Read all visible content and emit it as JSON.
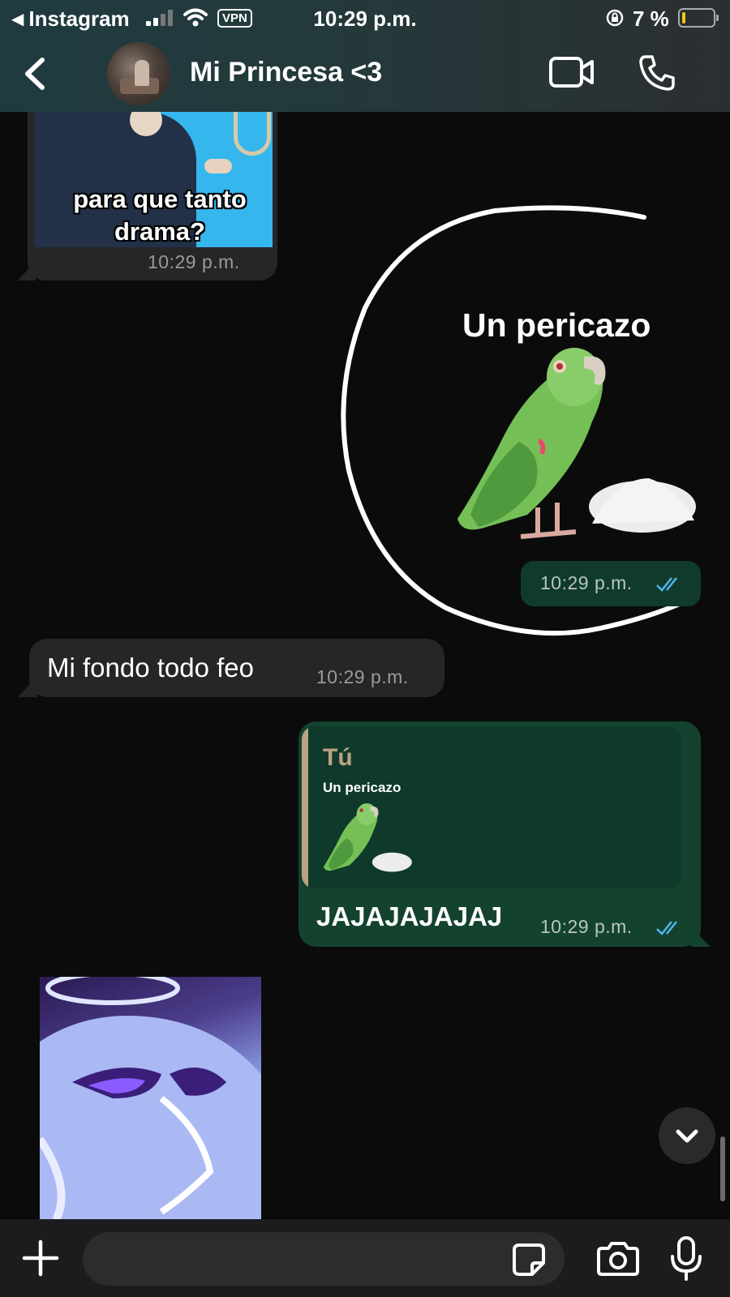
{
  "status_bar": {
    "back_app": "Instagram",
    "vpn": "VPN",
    "time": "10:29 p.m.",
    "battery": "7 %"
  },
  "header": {
    "contact_name": "Mi Princesa <3",
    "icons": [
      "back-chevron-icon",
      "avatar",
      "video-camera-icon",
      "phone-icon"
    ]
  },
  "messages": {
    "meme": {
      "caption_line1": "para  que tanto",
      "caption_line2": "drama?",
      "time": "10:29 p.m."
    },
    "sticker": {
      "caption": "Un pericazo",
      "time": "10:29 p.m.",
      "read": true
    },
    "text_in": {
      "text": "Mi fondo todo feo",
      "time": "10:29 p.m."
    },
    "reply": {
      "quoted_author": "Tú",
      "quoted_text": "Un pericazo",
      "text": "JAJAJAJAJAJ",
      "time": "10:29 p.m.",
      "read": true
    }
  },
  "composer": {
    "placeholder": "",
    "icons": [
      "plus-icon",
      "sticker-icon",
      "camera-icon",
      "microphone-icon"
    ]
  },
  "colors": {
    "incoming_bubble": "#262628",
    "outgoing_bubble": "#103b2c",
    "read_ticks": "#4fb6ec",
    "quote_accent": "#b9a383"
  }
}
